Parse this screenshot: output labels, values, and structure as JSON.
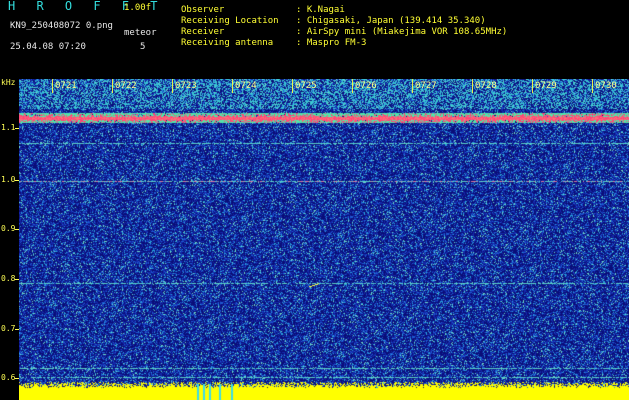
{
  "header": {
    "brand": "H R O F F T",
    "version": "1.00f",
    "filename": "KN9_250408072 0.png",
    "datetime": "25.04.08 07:20",
    "meteor_label": "meteor",
    "meteor_count": "5"
  },
  "meta": [
    {
      "key": "Observer",
      "value": ": K.Nagai"
    },
    {
      "key": "Receiving Location",
      "value": ": Chigasaki, Japan (139.414 35.340)"
    },
    {
      "key": "Receiver",
      "value": ": AirSpy mini (Miakejima VOR 108.65MHz)"
    },
    {
      "key": "Receiving antenna",
      "value": ": Maspro FM-3"
    }
  ],
  "axis": {
    "unit": "kHz",
    "labels": [
      "1.1",
      "1.0",
      "0.9",
      "0.8",
      "0.7",
      "0.6"
    ]
  },
  "time_labels": [
    "0721",
    "0722",
    "0723",
    "0724",
    "0725",
    "0726",
    "0727",
    "0728",
    "0729",
    "0730"
  ],
  "colors": {
    "background": "#000000",
    "axis": "#ffff55",
    "carrier": "#ff4488",
    "noise_floor": "#ffff00"
  }
}
